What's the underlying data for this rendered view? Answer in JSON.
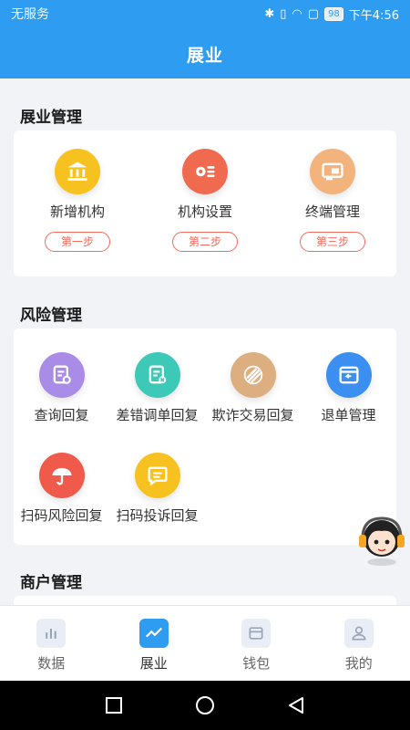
{
  "status_bar": {
    "carrier": "无服务",
    "battery": "98",
    "time": "下午4:56"
  },
  "header": {
    "title": "展业"
  },
  "sections": {
    "business": {
      "title": "展业管理",
      "items": [
        {
          "label": "新增机构",
          "step": "第一步",
          "icon": "bank-icon",
          "color": "#f7c21f"
        },
        {
          "label": "机构设置",
          "step": "第二步",
          "icon": "gear-list-icon",
          "color": "#f06a4f"
        },
        {
          "label": "终端管理",
          "step": "第三步",
          "icon": "terminal-icon",
          "color": "#f2b37c"
        }
      ]
    },
    "risk": {
      "title": "风险管理",
      "items": [
        {
          "label": "查询回复",
          "icon": "search-doc-icon",
          "color": "#a98ce8"
        },
        {
          "label": "差错调单回复",
          "icon": "doc-error-icon",
          "color": "#3cc9b7"
        },
        {
          "label": "欺诈交易回复",
          "icon": "stripes-icon",
          "color": "#dcae80"
        },
        {
          "label": "退单管理",
          "icon": "return-icon",
          "color": "#3b8ff0"
        },
        {
          "label": "扫码风险回复",
          "icon": "umbrella-icon",
          "color": "#f05a4a"
        },
        {
          "label": "扫码投诉回复",
          "icon": "chat-icon",
          "color": "#f7c21f"
        }
      ]
    },
    "merchant": {
      "title": "商户管理"
    }
  },
  "tabs": [
    {
      "label": "数据",
      "icon": "bar-chart-icon",
      "active": false
    },
    {
      "label": "展业",
      "icon": "trend-icon",
      "active": true
    },
    {
      "label": "钱包",
      "icon": "wallet-icon",
      "active": false
    },
    {
      "label": "我的",
      "icon": "person-icon",
      "active": false
    }
  ]
}
